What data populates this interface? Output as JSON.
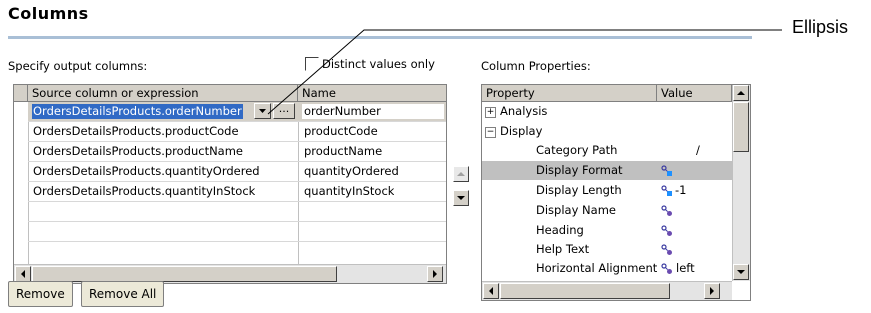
{
  "panel": {
    "title": "Columns",
    "specify_label": "Specify output columns:",
    "distinct_label": "Distinct values only",
    "properties_label": "Column Properties:",
    "callout_label": "Ellipsis"
  },
  "columns_grid": {
    "headers": [
      "Source column or expression",
      "Name"
    ],
    "rows": [
      {
        "source": "OrdersDetailsProducts.orderNumber",
        "name": "orderNumber"
      },
      {
        "source": "OrdersDetailsProducts.productCode",
        "name": "productCode"
      },
      {
        "source": "OrdersDetailsProducts.productName",
        "name": "productName"
      },
      {
        "source": "OrdersDetailsProducts.quantityOrdered",
        "name": "quantityOrdered"
      },
      {
        "source": "OrdersDetailsProducts.quantityInStock",
        "name": "quantityInStock"
      }
    ],
    "ellipsis_label": "..."
  },
  "buttons": {
    "remove": "Remove",
    "remove_all": "Remove All"
  },
  "properties_grid": {
    "headers": [
      "Property",
      "Value"
    ],
    "groups": [
      {
        "label": "Analysis",
        "expander": "+"
      },
      {
        "label": "Display",
        "expander": "−"
      }
    ],
    "items": [
      {
        "label": "Category Path",
        "value": "/"
      },
      {
        "label": "Display Format",
        "value": ""
      },
      {
        "label": "Display Length",
        "value": "-1"
      },
      {
        "label": "Display Name",
        "value": ""
      },
      {
        "label": "Heading",
        "value": ""
      },
      {
        "label": "Help Text",
        "value": ""
      },
      {
        "label": "Horizontal Alignment",
        "value": "left"
      }
    ]
  },
  "colors": {
    "selection": "#316ac5",
    "header_gray": "#d4d0c8",
    "title_rule": "#a9bfd6"
  }
}
